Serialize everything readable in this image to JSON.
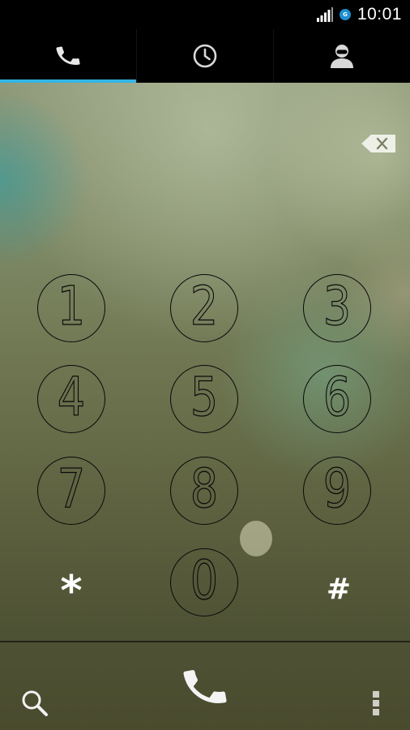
{
  "status_bar": {
    "time": "10:01",
    "badge_text": "G",
    "icons": [
      "signal-icon",
      "gear-icon"
    ]
  },
  "tabs": [
    {
      "name": "phone",
      "icon": "phone-icon",
      "active": true
    },
    {
      "name": "recent",
      "icon": "clock-icon",
      "active": false
    },
    {
      "name": "contacts",
      "icon": "person-icon",
      "active": false
    }
  ],
  "colors": {
    "accent": "#33b5e5",
    "badge": "#1d8fd0"
  },
  "keypad": {
    "keys": [
      "1",
      "2",
      "3",
      "4",
      "5",
      "6",
      "7",
      "8",
      "9",
      "*",
      "0",
      "#"
    ]
  },
  "actions": {
    "icons": [
      "search-icon",
      "call-icon",
      "overflow-icon",
      "backspace-icon"
    ]
  }
}
